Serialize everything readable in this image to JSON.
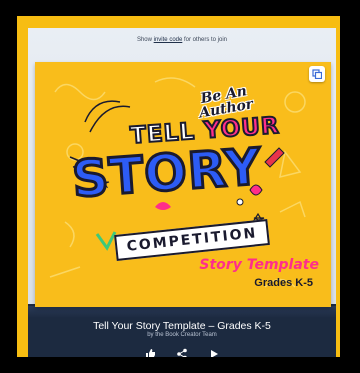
{
  "header": {
    "invite_prefix": "Show ",
    "invite_link": "invite code",
    "invite_suffix": " for others to join"
  },
  "cover": {
    "be_an_author": "Be An Author",
    "tell": "TELL ",
    "your": "YOUR",
    "story": "STORY",
    "competition": "COMPETITION",
    "story_template": "Story Template",
    "grades": "Grades K-5",
    "accent_color": "#ff2e8b",
    "story_color": "#2d5cf5",
    "background_color": "#f9bd1b"
  },
  "footer": {
    "title": "Tell Your Story Template – Grades K-5",
    "byline": "by the Book Creator Team"
  },
  "icons": [
    "copy-icon",
    "like-icon",
    "share-icon",
    "play-icon"
  ]
}
